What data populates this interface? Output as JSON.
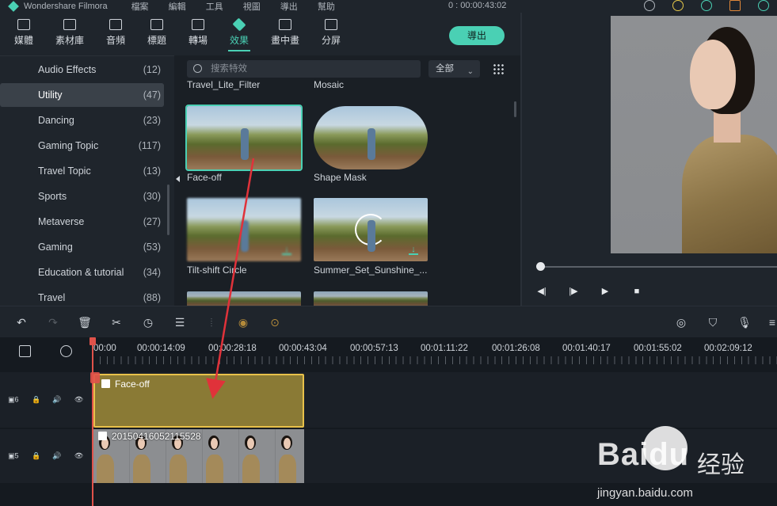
{
  "titlebar": {
    "app_name": "Wondershare Filmora",
    "menu": [
      "檔案",
      "編輯",
      "工具",
      "視圖",
      "導出",
      "幫助"
    ],
    "timecode": "0 : 00:00:43:02"
  },
  "toolbar": {
    "tabs": [
      {
        "label": "媒體",
        "icon": "folder-icon"
      },
      {
        "label": "素材庫",
        "icon": "image-icon"
      },
      {
        "label": "音頻",
        "icon": "music-note-icon"
      },
      {
        "label": "標題",
        "icon": "text-icon"
      },
      {
        "label": "轉場",
        "icon": "transition-icon"
      },
      {
        "label": "效果",
        "icon": "effects-icon",
        "active": true
      },
      {
        "label": "畫中畫",
        "icon": "pip-icon"
      },
      {
        "label": "分屏",
        "icon": "split-screen-icon"
      }
    ],
    "export_label": "導出"
  },
  "sidebar": {
    "categories": [
      {
        "label": "Audio Effects",
        "count": "(12)"
      },
      {
        "label": "Utility",
        "count": "(47)",
        "selected": true
      },
      {
        "label": "Dancing",
        "count": "(23)"
      },
      {
        "label": "Gaming Topic",
        "count": "(117)"
      },
      {
        "label": "Travel Topic",
        "count": "(13)"
      },
      {
        "label": "Sports",
        "count": "(30)"
      },
      {
        "label": "Metaverse",
        "count": "(27)"
      },
      {
        "label": "Gaming",
        "count": "(53)"
      },
      {
        "label": "Education & tutorial",
        "count": "(34)"
      },
      {
        "label": "Travel",
        "count": "(88)"
      }
    ]
  },
  "effects": {
    "search_placeholder": "搜索特效",
    "filter_value": "全部",
    "top_labels": [
      "Travel_Lite_Filter",
      "Mosaic"
    ],
    "items": [
      {
        "label": "Face-off",
        "selected": true
      },
      {
        "label": "Shape Mask"
      },
      {
        "label": "Tilt-shift Circle",
        "downloadable": true
      },
      {
        "label": "Summer_Set_Sunshine_...",
        "downloadable": true
      }
    ]
  },
  "timeline": {
    "ruler_labels": [
      "00:00",
      "00:00:14:09",
      "00:00:28:18",
      "00:00:43:04",
      "00:00:57:13",
      "00:01:11:22",
      "00:01:26:08",
      "00:01:40:17",
      "00:01:55:02",
      "00:02:09:12"
    ],
    "tracks": [
      {
        "number": "6",
        "clip_label": "Face-off"
      },
      {
        "number": "5",
        "clip_label": "20150416052115528"
      }
    ]
  },
  "watermark": {
    "logo": "Baidu",
    "cn": "经验",
    "url": "jingyan.baidu.com"
  },
  "colors": {
    "accent": "#4ad0b4",
    "effect_clip": "#8a7a35",
    "effect_clip_border": "#e8c14a",
    "playhead": "#e0524a",
    "annotation_arrow": "#e0323a"
  }
}
